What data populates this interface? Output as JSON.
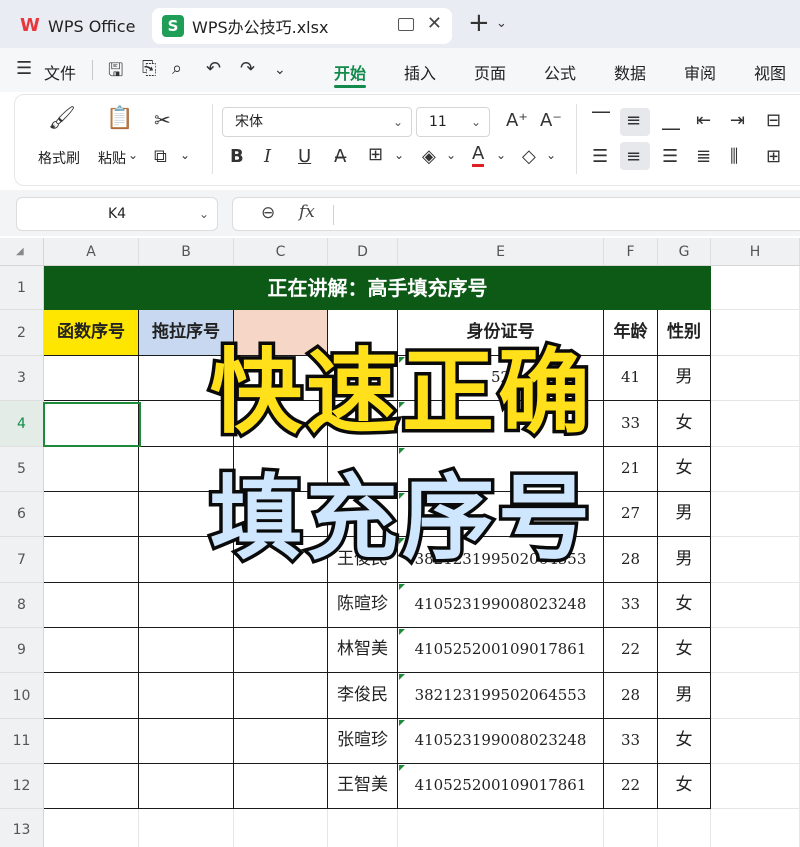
{
  "tabs": {
    "home_label": "WPS Office",
    "file_label": "WPS办公技巧.xlsx",
    "new_tab": "+"
  },
  "menu": {
    "file": "文件",
    "items": [
      "开始",
      "插入",
      "页面",
      "公式",
      "数据",
      "审阅",
      "视图"
    ],
    "active": "开始"
  },
  "ribbon": {
    "format_painter": "格式刷",
    "paste": "粘贴",
    "font_name": "宋体",
    "font_size": "11"
  },
  "formula_bar": {
    "cell_ref": "K4",
    "fx": "fx",
    "value": ""
  },
  "sheet": {
    "columns": [
      "A",
      "B",
      "C",
      "D",
      "E",
      "F",
      "G",
      "H"
    ],
    "rows": [
      "1",
      "2",
      "3",
      "4",
      "5",
      "6",
      "7",
      "8",
      "9",
      "10",
      "11",
      "12",
      "13"
    ],
    "title": "正在讲解：高手填充序号",
    "headers": {
      "A": "函数序号",
      "B": "拖拉序号",
      "E": "身份证号",
      "F": "年龄",
      "G": "性别"
    },
    "data_rows": [
      {
        "D": "",
        "E": "52",
        "F": "41",
        "G": "男"
      },
      {
        "D": "",
        "E": "",
        "F": "33",
        "G": "女"
      },
      {
        "D": "",
        "E": "",
        "F": "21",
        "G": "女"
      },
      {
        "D": "",
        "E": "",
        "F": "27",
        "G": "男"
      },
      {
        "D": "王俊民",
        "E": "382123199502064553",
        "F": "28",
        "G": "男"
      },
      {
        "D": "陈暄珍",
        "E": "410523199008023248",
        "F": "33",
        "G": "女"
      },
      {
        "D": "林智美",
        "E": "410525200109017861",
        "F": "22",
        "G": "女"
      },
      {
        "D": "李俊民",
        "E": "382123199502064553",
        "F": "28",
        "G": "男"
      },
      {
        "D": "张暄珍",
        "E": "410523199008023248",
        "F": "33",
        "G": "女"
      },
      {
        "D": "王智美",
        "E": "410525200109017861",
        "F": "22",
        "G": "女"
      }
    ]
  },
  "overlay": {
    "line1": "快速正确",
    "line2": "填充序号"
  }
}
